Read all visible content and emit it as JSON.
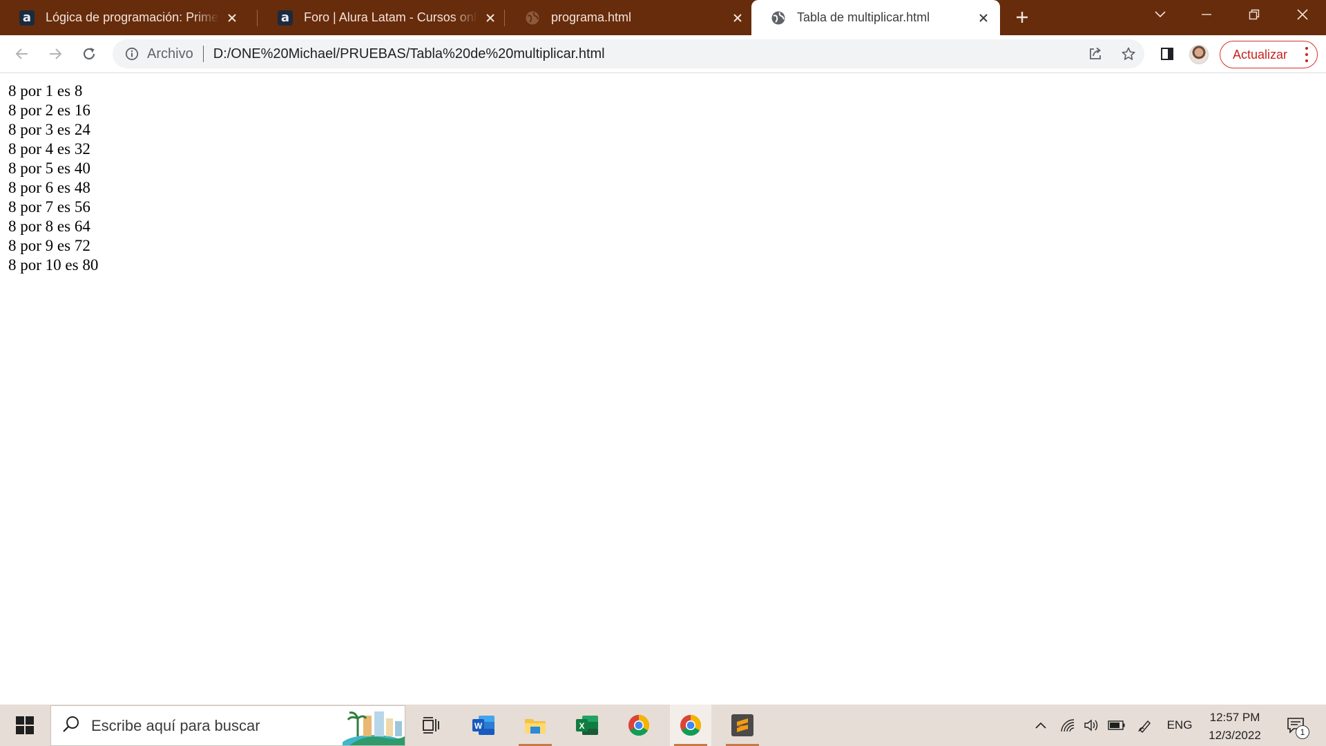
{
  "browser": {
    "tabs": [
      {
        "title": "Lógica de programación: Primeros",
        "favicon": "alura-icon",
        "active": false
      },
      {
        "title": "Foro | Alura Latam - Cursos online",
        "favicon": "alura-icon",
        "active": false
      },
      {
        "title": "programa.html",
        "favicon": "globe-icon",
        "active": false
      },
      {
        "title": "Tabla de multiplicar.html",
        "favicon": "globe-icon",
        "active": true
      }
    ],
    "address_bar": {
      "scheme_label": "Archivo",
      "url": "D:/ONE%20Michael/PRUEBAS/Tabla%20de%20multiplicar.html"
    },
    "update_button_label": "Actualizar",
    "colors": {
      "frame": "#662c0c",
      "update_accent": "#c5221f"
    }
  },
  "page": {
    "lines": [
      "8 por 1 es 8",
      "8 por 2 es 16",
      "8 por 3 es 24",
      "8 por 4 es 32",
      "8 por 5 es 40",
      "8 por 6 es 48",
      "8 por 7 es 56",
      "8 por 8 es 64",
      "8 por 9 es 72",
      "8 por 10 es 80"
    ]
  },
  "taskbar": {
    "search_placeholder": "Escribe aquí para buscar",
    "apps": [
      "task-view",
      "word",
      "file-explorer",
      "excel",
      "chrome",
      "chrome",
      "sublime-text"
    ],
    "tray": {
      "language": "ENG",
      "time": "12:57 PM",
      "date": "12/3/2022",
      "notification_count": "1"
    }
  }
}
